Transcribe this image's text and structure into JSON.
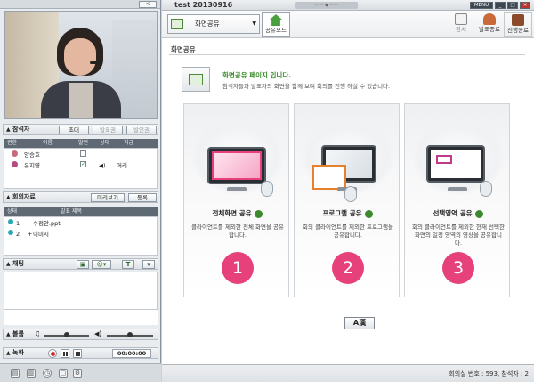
{
  "left_panel": {
    "collapse_label": "<",
    "participants": {
      "title": "참석자",
      "buttons": [
        "초대",
        "발표권",
        "발언권"
      ],
      "columns": [
        "권한",
        "이름",
        "발언",
        "상태",
        "직급"
      ],
      "rows": [
        {
          "name": "양승호",
          "status": ""
        },
        {
          "name": "유지영",
          "status": "머리"
        }
      ]
    },
    "materials": {
      "title": "회의자료",
      "buttons": [
        "미리보기",
        "등록"
      ],
      "columns": [
        "상태",
        "발표 제목"
      ],
      "rows": [
        {
          "index": "1",
          "title": "수정안.ppt"
        },
        {
          "index": "2",
          "title": "이미지"
        }
      ]
    },
    "chat": {
      "title": "채팅",
      "font_button": "T"
    },
    "volume": {
      "title": "볼륨",
      "speaker_level": 0.5,
      "mic_level": 0.5
    },
    "record": {
      "title": "녹화",
      "time": "00:00:00"
    }
  },
  "titlebar": {
    "title": "test 20130916",
    "menu_label": "MENU"
  },
  "toolbar": {
    "mode": "화면공유",
    "home_label": "공유모드",
    "buttons": [
      "판서",
      "발표종료",
      "진행종료"
    ]
  },
  "content": {
    "section_title": "화면공유",
    "intro_title": "화면공유 페이지 입니다.",
    "intro_desc": "참석자들과 발표자의 화면을 함께 보며 회의를 진행 하실 수 있습니다.",
    "cards": [
      {
        "label": "전체화면 공유",
        "desc": "클라이언트를 제외한 전체 화면을 공유합니다.",
        "num": "1"
      },
      {
        "label": "프로그램 공유",
        "desc": "회의 클라이언트를 제외한 프로그램을 공유합니다.",
        "num": "2"
      },
      {
        "label": "선택영역 공유",
        "desc": "회의 클라이언트를 제외한 현재 선택한 화면의 일정 영역의 영상을 공유합니다.",
        "num": "3"
      }
    ],
    "font_button": "A漢"
  },
  "status": {
    "text": "회의실 번호 : 593, 참석자 : 2"
  },
  "colors": {
    "accent_green": "#3d8a2e",
    "number_pink": "#e6417a",
    "header_dark": "#5f6974"
  }
}
